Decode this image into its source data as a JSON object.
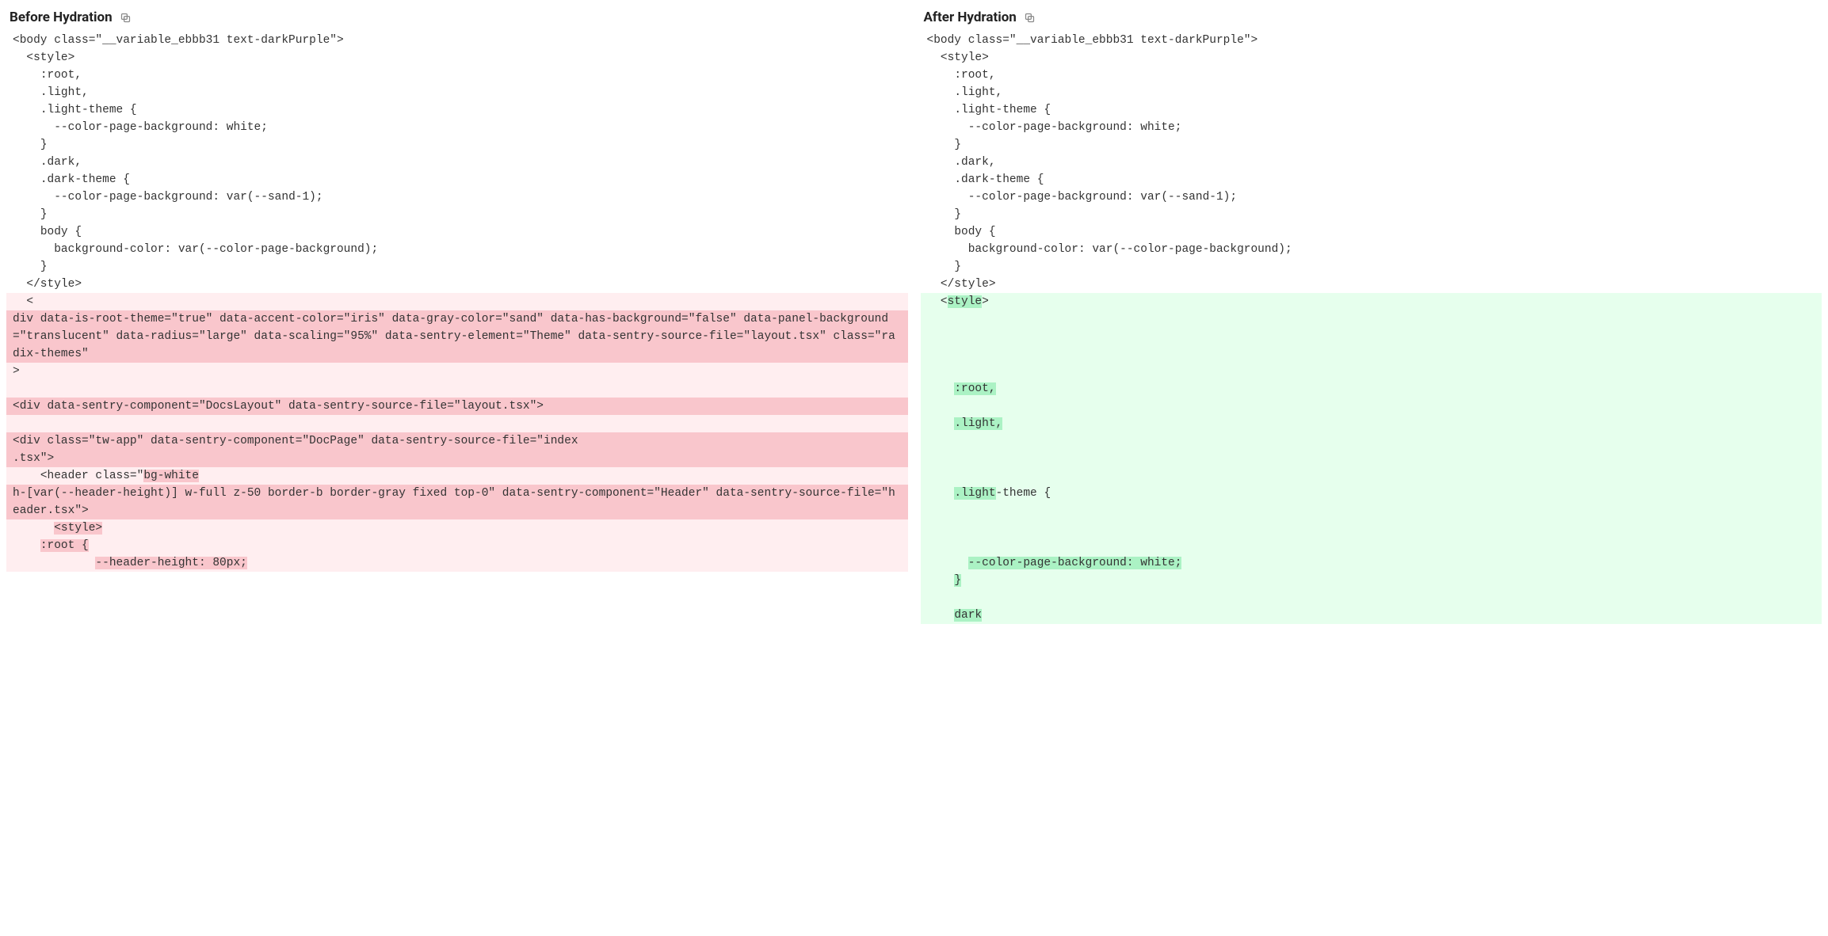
{
  "left": {
    "title": "Before Hydration",
    "copy_icon": "copy-icon",
    "lines": [
      {
        "text": "<body class=\"__variable_ebbb31 text-darkPurple\">",
        "cls": ""
      },
      {
        "text": "  <style>",
        "cls": ""
      },
      {
        "text": "    :root,",
        "cls": ""
      },
      {
        "text": "    .light,",
        "cls": ""
      },
      {
        "text": "    .light-theme {",
        "cls": ""
      },
      {
        "text": "      --color-page-background: white;",
        "cls": ""
      },
      {
        "text": "    }",
        "cls": ""
      },
      {
        "text": "    .dark,",
        "cls": ""
      },
      {
        "text": "    .dark-theme {",
        "cls": ""
      },
      {
        "text": "      --color-page-background: var(--sand-1);",
        "cls": ""
      },
      {
        "text": "    }",
        "cls": ""
      },
      {
        "text": "    body {",
        "cls": ""
      },
      {
        "text": "      background-color: var(--color-page-background);",
        "cls": ""
      },
      {
        "text": "    }",
        "cls": ""
      },
      {
        "text": "  </style>",
        "cls": ""
      },
      {
        "text": "  <",
        "cls": "diff-del-light"
      },
      {
        "text": "div data-is-root-theme=\"true\" data-accent-color=\"iris\" data-gray-color=\"sand\" data-has-background=\"false\" data-panel-background=\"translucent\" data-radius=\"large\" data-scaling=\"95%\" data-sentry-element=\"Theme\" data-sentry-source-file=\"layout.tsx\" class=\"radix-themes\"",
        "cls": "diff-del-dark"
      },
      {
        "text": ">",
        "cls": "diff-del-light"
      },
      {
        "text": "",
        "cls": "diff-del-light"
      },
      {
        "text": "<div data-sentry-component=\"DocsLayout\" data-sentry-source-file=\"layout.tsx\">",
        "cls": "diff-del-dark"
      },
      {
        "text": "",
        "cls": "diff-del-light"
      },
      {
        "text": "<div class=\"tw-app\" data-sentry-component=\"DocPage\" data-sentry-source-file=\"index",
        "cls": "diff-del-dark"
      },
      {
        "text": ".tsx\">",
        "cls": "diff-del-dark"
      },
      {
        "segments": [
          {
            "text": "    <header class=\"",
            "cls": ""
          },
          {
            "text": "bg-white",
            "cls": "hl-del"
          }
        ],
        "cls": "diff-del-light"
      },
      {
        "text": "h-[var(--header-height)] w-full z-50 border-b border-gray fixed top-0\" data-sentry-component=\"Header\" data-sentry-source-file=\"header.tsx\">",
        "cls": "diff-del-dark"
      },
      {
        "segments": [
          {
            "text": "      ",
            "cls": ""
          },
          {
            "text": "<style>",
            "cls": "hl-del"
          }
        ],
        "cls": "diff-del-light"
      },
      {
        "segments": [
          {
            "text": "    ",
            "cls": ""
          },
          {
            "text": ":root {",
            "cls": "hl-del"
          }
        ],
        "cls": "diff-del-light"
      },
      {
        "segments": [
          {
            "text": "            ",
            "cls": ""
          },
          {
            "text": "--header-height: 80px;",
            "cls": "hl-del"
          }
        ],
        "cls": "diff-del-light"
      }
    ]
  },
  "right": {
    "title": "After Hydration",
    "copy_icon": "copy-icon",
    "lines": [
      {
        "text": "<body class=\"__variable_ebbb31 text-darkPurple\">",
        "cls": ""
      },
      {
        "text": "  <style>",
        "cls": ""
      },
      {
        "text": "    :root,",
        "cls": ""
      },
      {
        "text": "    .light,",
        "cls": ""
      },
      {
        "text": "    .light-theme {",
        "cls": ""
      },
      {
        "text": "      --color-page-background: white;",
        "cls": ""
      },
      {
        "text": "    }",
        "cls": ""
      },
      {
        "text": "    .dark,",
        "cls": ""
      },
      {
        "text": "    .dark-theme {",
        "cls": ""
      },
      {
        "text": "      --color-page-background: var(--sand-1);",
        "cls": ""
      },
      {
        "text": "    }",
        "cls": ""
      },
      {
        "text": "    body {",
        "cls": ""
      },
      {
        "text": "      background-color: var(--color-page-background);",
        "cls": ""
      },
      {
        "text": "    }",
        "cls": ""
      },
      {
        "text": "  </style>",
        "cls": ""
      },
      {
        "segments": [
          {
            "text": "  <",
            "cls": ""
          },
          {
            "text": "style",
            "cls": "hl-add"
          },
          {
            "text": ">",
            "cls": ""
          }
        ],
        "cls": "diff-add-light"
      },
      {
        "text": "",
        "cls": "diff-add-light"
      },
      {
        "text": "",
        "cls": "diff-add-light"
      },
      {
        "text": "",
        "cls": "diff-add-light"
      },
      {
        "text": "",
        "cls": "diff-add-light"
      },
      {
        "segments": [
          {
            "text": "    ",
            "cls": ""
          },
          {
            "text": ":root,",
            "cls": "hl-add"
          }
        ],
        "cls": "diff-add-light"
      },
      {
        "text": "",
        "cls": "diff-add-light"
      },
      {
        "segments": [
          {
            "text": "    ",
            "cls": ""
          },
          {
            "text": ".light,",
            "cls": "hl-add"
          }
        ],
        "cls": "diff-add-light"
      },
      {
        "text": "",
        "cls": "diff-add-light"
      },
      {
        "text": "",
        "cls": "diff-add-light"
      },
      {
        "text": "",
        "cls": "diff-add-light"
      },
      {
        "segments": [
          {
            "text": "    ",
            "cls": ""
          },
          {
            "text": ".light",
            "cls": "hl-add"
          },
          {
            "text": "-theme {",
            "cls": ""
          }
        ],
        "cls": "diff-add-light"
      },
      {
        "text": "",
        "cls": "diff-add-light"
      },
      {
        "text": "",
        "cls": "diff-add-light"
      },
      {
        "text": "",
        "cls": "diff-add-light"
      },
      {
        "segments": [
          {
            "text": "      ",
            "cls": ""
          },
          {
            "text": "--color-page-background: white;",
            "cls": "hl-add"
          }
        ],
        "cls": "diff-add-light"
      },
      {
        "segments": [
          {
            "text": "    ",
            "cls": ""
          },
          {
            "text": "}",
            "cls": "hl-add"
          }
        ],
        "cls": "diff-add-light"
      },
      {
        "text": "",
        "cls": "diff-add-light"
      },
      {
        "segments": [
          {
            "text": "    ",
            "cls": ""
          },
          {
            "text": "dark",
            "cls": "hl-add"
          }
        ],
        "cls": "diff-add-light"
      }
    ]
  }
}
